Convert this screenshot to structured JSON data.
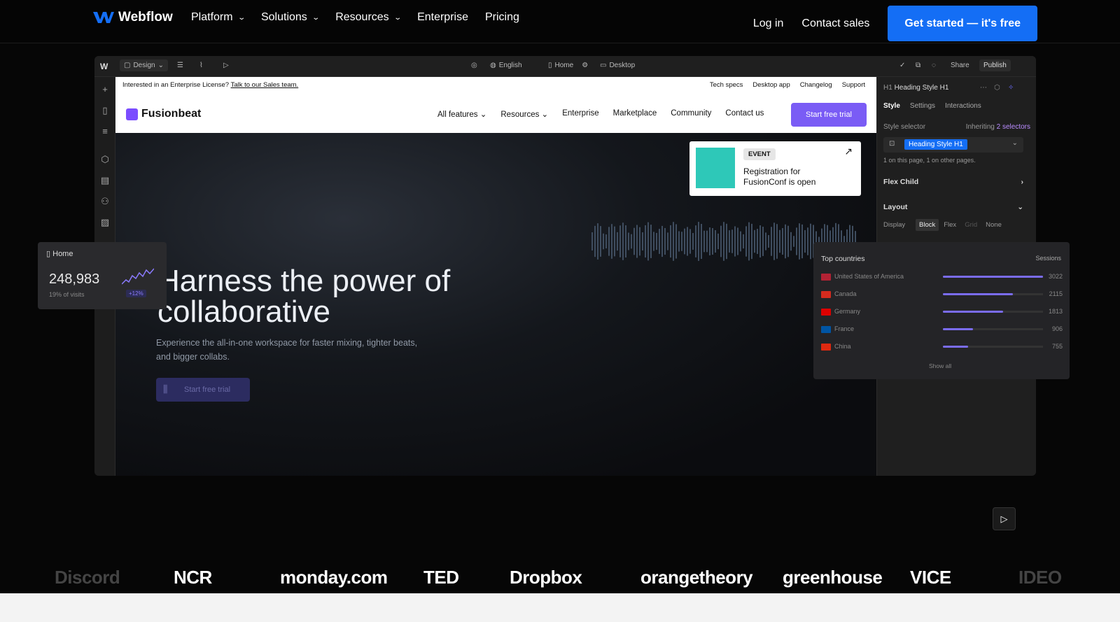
{
  "topnav": {
    "brand": "Webflow",
    "links": [
      {
        "label": "Platform",
        "dropdown": true
      },
      {
        "label": "Solutions",
        "dropdown": true
      },
      {
        "label": "Resources",
        "dropdown": true
      },
      {
        "label": "Enterprise",
        "dropdown": false
      },
      {
        "label": "Pricing",
        "dropdown": false
      }
    ],
    "login": "Log in",
    "contact": "Contact sales",
    "cta": "Get started — it's free",
    "cta_color": "#146ef5"
  },
  "editor": {
    "toolbar": {
      "mode": "Design",
      "locale": "English",
      "page": "Home",
      "breakpoint": "Desktop",
      "share": "Share",
      "publish": "Publish"
    },
    "site": {
      "announce_text": "Interested in an Enterprise License?",
      "announce_link": "Talk to our Sales team.",
      "top_links": [
        "Tech specs",
        "Desktop app",
        "Changelog",
        "Support"
      ],
      "logo": "Fusionbeat",
      "nav": [
        {
          "label": "All features",
          "dropdown": true
        },
        {
          "label": "Resources",
          "dropdown": true
        },
        {
          "label": "Enterprise",
          "dropdown": false
        },
        {
          "label": "Marketplace",
          "dropdown": false
        },
        {
          "label": "Community",
          "dropdown": false
        },
        {
          "label": "Contact us",
          "dropdown": false
        }
      ],
      "cta": "Start free trial",
      "hero_title_1": "Harness the power of",
      "hero_title_2": "collaborative",
      "hero_sub": "Experience the all-in-one workspace for faster mixing, tighter beats, and bigger collabs.",
      "hero_button": "Start free trial",
      "event_tag": "EVENT",
      "event_text": "Registration for FusionConf is open"
    },
    "panel": {
      "element": "Heading Style H1",
      "tabs": [
        "Style",
        "Settings",
        "Interactions"
      ],
      "selector_label": "Style selector",
      "inheriting": "Inheriting",
      "inheriting_count": "2 selectors",
      "selector_value": "Heading Style H1",
      "usage": "1 on this page, 1 on other pages.",
      "flex_child": "Flex Child",
      "layout": "Layout",
      "display_label": "Display",
      "display_options": [
        "Block",
        "Flex",
        "Grid",
        "None"
      ]
    }
  },
  "home_card": {
    "title": "Home",
    "value": "248,983",
    "sub": "19% of visits",
    "badge": "+12%"
  },
  "countries": {
    "title": "Top countries",
    "sessions_label": "Sessions",
    "rows": [
      {
        "name": "United States of America",
        "value": "3022",
        "share": 1.0,
        "flag": "#b22234"
      },
      {
        "name": "Canada",
        "value": "2115",
        "share": 0.7,
        "flag": "#d52b1e"
      },
      {
        "name": "Germany",
        "value": "1813",
        "share": 0.6,
        "flag": "#dd0000"
      },
      {
        "name": "France",
        "value": "906",
        "share": 0.3,
        "flag": "#0055a4"
      },
      {
        "name": "China",
        "value": "755",
        "share": 0.25,
        "flag": "#de2910"
      }
    ],
    "show_all": "Show all"
  },
  "logos": [
    "Discord",
    "NCR",
    "monday.com",
    "TED",
    "Dropbox",
    "orangetheory",
    "greenhouse",
    "VICE",
    "IDEO"
  ]
}
